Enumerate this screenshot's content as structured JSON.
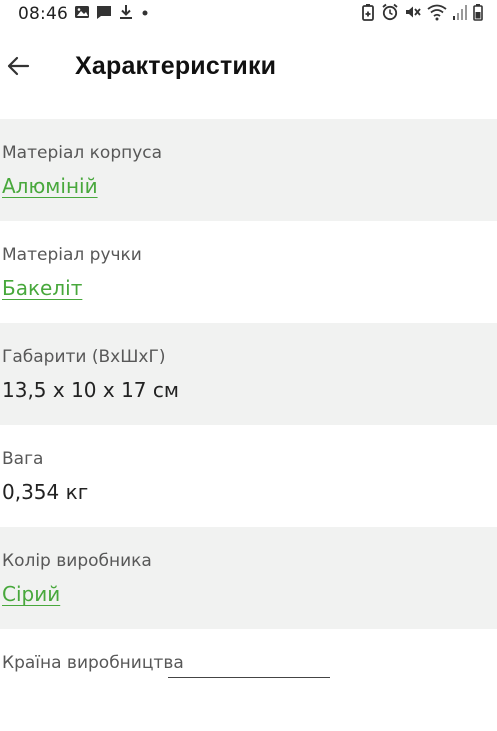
{
  "status_bar": {
    "time": "08:46",
    "left_icons": [
      "image-icon",
      "message-icon",
      "download-icon",
      "dot-icon"
    ],
    "right_icons": [
      "battery-saver-icon",
      "alarm-icon",
      "mute-icon",
      "wifi-icon",
      "signal-icon",
      "battery-icon"
    ]
  },
  "header": {
    "back_icon": "arrow-left-icon",
    "title": "Характеристики"
  },
  "specs": [
    {
      "label": "Матеріал корпуса",
      "value": "Алюміній",
      "is_link": true
    },
    {
      "label": "Матеріал ручки",
      "value": "Бакеліт",
      "is_link": true
    },
    {
      "label": "Габарити (ВхШхГ)",
      "value": "13,5 х 10 х 17 см",
      "is_link": false
    },
    {
      "label": "Вага",
      "value": "0,354 кг",
      "is_link": false
    },
    {
      "label": "Колір виробника",
      "value": "Сірий",
      "is_link": true
    },
    {
      "label": "Країна виробництва",
      "value": "",
      "is_link": false
    }
  ],
  "colors": {
    "link": "#48a83c",
    "row_shade": "#f1f2f1",
    "label": "#585858",
    "value": "#222222"
  }
}
